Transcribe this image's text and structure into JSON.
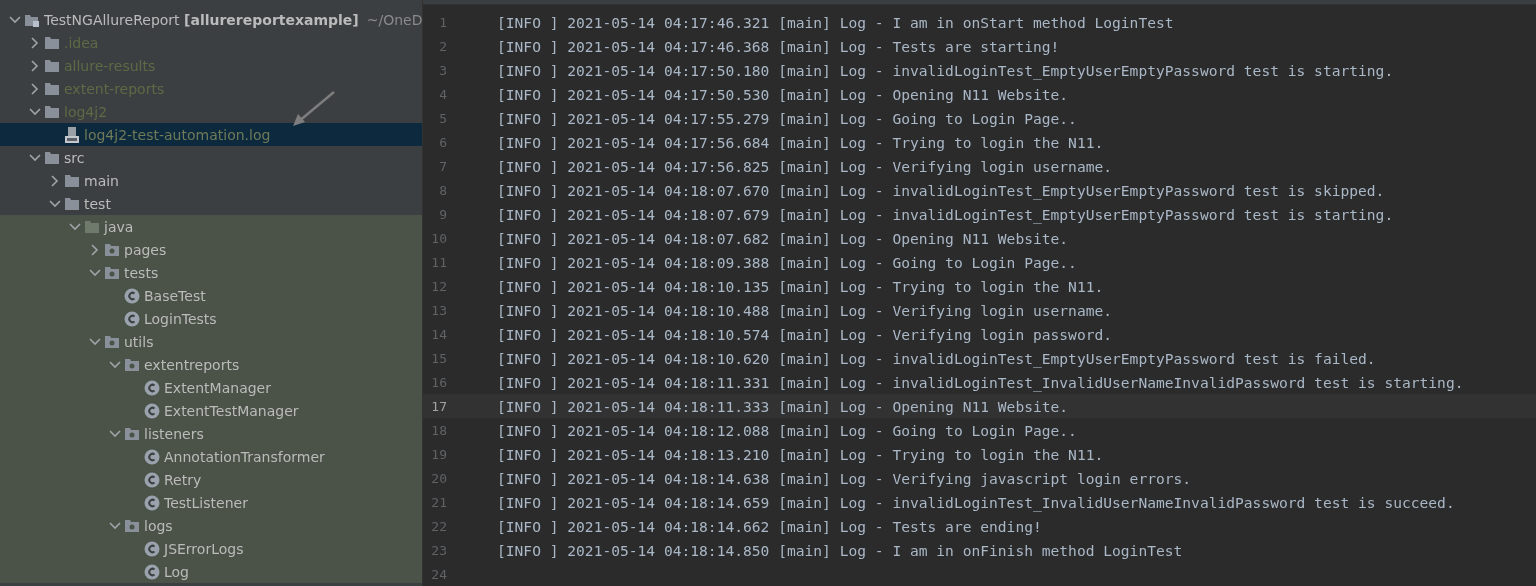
{
  "project_tree": [
    {
      "kind": "module",
      "label": "TestNGAllureReport **[allurereportexample]**",
      "path": "~/OneD",
      "expanded": true,
      "selected": false,
      "children": [
        {
          "kind": "folder",
          "label": ".idea",
          "excluded": true,
          "expanded": false,
          "selected": false
        },
        {
          "kind": "folder",
          "label": "allure-results",
          "excluded": true,
          "expanded": false,
          "selected": false
        },
        {
          "kind": "folder",
          "label": "extent-reports",
          "excluded": true,
          "expanded": false,
          "selected": false
        },
        {
          "kind": "folder",
          "label": "log4j2",
          "excluded": true,
          "expanded": true,
          "selected": false,
          "children": [
            {
              "kind": "log",
              "label": "log4j2-test-automation.log",
              "excluded": true,
              "selected": true
            }
          ]
        },
        {
          "kind": "folder",
          "label": "src",
          "excluded": false,
          "expanded": true,
          "selected": false,
          "children": [
            {
              "kind": "folder",
              "label": "main",
              "excluded": false,
              "expanded": false,
              "selected": false
            },
            {
              "kind": "folder",
              "label": "test",
              "excluded": false,
              "expanded": true,
              "selected": false,
              "children": [
                {
                  "kind": "test-root",
                  "label": "java",
                  "excluded": false,
                  "expanded": true,
                  "selected": false,
                  "children": [
                    {
                      "kind": "package",
                      "label": "pages",
                      "excluded": false,
                      "expanded": false,
                      "selected": false
                    },
                    {
                      "kind": "package",
                      "label": "tests",
                      "excluded": false,
                      "expanded": true,
                      "selected": false,
                      "children": [
                        {
                          "kind": "class",
                          "label": "BaseTest",
                          "excluded": false,
                          "selected": false
                        },
                        {
                          "kind": "class",
                          "label": "LoginTests",
                          "excluded": false,
                          "selected": false
                        }
                      ]
                    },
                    {
                      "kind": "package",
                      "label": "utils",
                      "excluded": false,
                      "expanded": true,
                      "selected": false,
                      "children": [
                        {
                          "kind": "package",
                          "label": "extentreports",
                          "excluded": false,
                          "expanded": true,
                          "selected": false,
                          "children": [
                            {
                              "kind": "class",
                              "label": "ExtentManager",
                              "excluded": false,
                              "selected": false
                            },
                            {
                              "kind": "class",
                              "label": "ExtentTestManager",
                              "excluded": false,
                              "selected": false
                            }
                          ]
                        },
                        {
                          "kind": "package",
                          "label": "listeners",
                          "excluded": false,
                          "expanded": true,
                          "selected": false,
                          "children": [
                            {
                              "kind": "class",
                              "label": "AnnotationTransformer",
                              "excluded": false,
                              "selected": false
                            },
                            {
                              "kind": "class",
                              "label": "Retry",
                              "excluded": false,
                              "selected": false
                            },
                            {
                              "kind": "class",
                              "label": "TestListener",
                              "excluded": false,
                              "selected": false
                            }
                          ]
                        },
                        {
                          "kind": "package",
                          "label": "logs",
                          "excluded": false,
                          "expanded": true,
                          "selected": false,
                          "children": [
                            {
                              "kind": "class",
                              "label": "JSErrorLogs",
                              "excluded": false,
                              "selected": false
                            },
                            {
                              "kind": "class",
                              "label": "Log",
                              "excluded": false,
                              "selected": false
                            }
                          ]
                        }
                      ]
                    }
                  ]
                }
              ]
            }
          ]
        }
      ]
    }
  ],
  "editor": {
    "lines": [
      {
        "number": "1",
        "text": "[INFO ] 2021-05-14 04:17:46.321 [main] Log - I am in onStart method LoginTest",
        "current": false
      },
      {
        "number": "2",
        "text": "[INFO ] 2021-05-14 04:17:46.368 [main] Log - Tests are starting!",
        "current": false
      },
      {
        "number": "3",
        "text": "[INFO ] 2021-05-14 04:17:50.180 [main] Log - invalidLoginTest_EmptyUserEmptyPassword test is starting.",
        "current": false
      },
      {
        "number": "4",
        "text": "[INFO ] 2021-05-14 04:17:50.530 [main] Log - Opening N11 Website.",
        "current": false
      },
      {
        "number": "5",
        "text": "[INFO ] 2021-05-14 04:17:55.279 [main] Log - Going to Login Page..",
        "current": false
      },
      {
        "number": "6",
        "text": "[INFO ] 2021-05-14 04:17:56.684 [main] Log - Trying to login the N11.",
        "current": false
      },
      {
        "number": "7",
        "text": "[INFO ] 2021-05-14 04:17:56.825 [main] Log - Verifying login username.",
        "current": false
      },
      {
        "number": "8",
        "text": "[INFO ] 2021-05-14 04:18:07.670 [main] Log - invalidLoginTest_EmptyUserEmptyPassword test is skipped.",
        "current": false
      },
      {
        "number": "9",
        "text": "[INFO ] 2021-05-14 04:18:07.679 [main] Log - invalidLoginTest_EmptyUserEmptyPassword test is starting.",
        "current": false
      },
      {
        "number": "10",
        "text": "[INFO ] 2021-05-14 04:18:07.682 [main] Log - Opening N11 Website.",
        "current": false
      },
      {
        "number": "11",
        "text": "[INFO ] 2021-05-14 04:18:09.388 [main] Log - Going to Login Page..",
        "current": false
      },
      {
        "number": "12",
        "text": "[INFO ] 2021-05-14 04:18:10.135 [main] Log - Trying to login the N11.",
        "current": false
      },
      {
        "number": "13",
        "text": "[INFO ] 2021-05-14 04:18:10.488 [main] Log - Verifying login username.",
        "current": false
      },
      {
        "number": "14",
        "text": "[INFO ] 2021-05-14 04:18:10.574 [main] Log - Verifying login password.",
        "current": false
      },
      {
        "number": "15",
        "text": "[INFO ] 2021-05-14 04:18:10.620 [main] Log - invalidLoginTest_EmptyUserEmptyPassword test is failed.",
        "current": false
      },
      {
        "number": "16",
        "text": "[INFO ] 2021-05-14 04:18:11.331 [main] Log - invalidLoginTest_InvalidUserNameInvalidPassword test is starting.",
        "current": false
      },
      {
        "number": "17",
        "text": "[INFO ] 2021-05-14 04:18:11.333 [main] Log - Opening N11 Website.",
        "current": true
      },
      {
        "number": "18",
        "text": "[INFO ] 2021-05-14 04:18:12.088 [main] Log - Going to Login Page..",
        "current": false
      },
      {
        "number": "19",
        "text": "[INFO ] 2021-05-14 04:18:13.210 [main] Log - Trying to login the N11.",
        "current": false
      },
      {
        "number": "20",
        "text": "[INFO ] 2021-05-14 04:18:14.638 [main] Log - Verifying javascript login errors.",
        "current": false
      },
      {
        "number": "21",
        "text": "[INFO ] 2021-05-14 04:18:14.659 [main] Log - invalidLoginTest_InvalidUserNameInvalidPassword test is succeed.",
        "current": false
      },
      {
        "number": "22",
        "text": "[INFO ] 2021-05-14 04:18:14.662 [main] Log - Tests are ending!",
        "current": false
      },
      {
        "number": "23",
        "text": "[INFO ] 2021-05-14 04:18:14.850 [main] Log - I am in onFinish method LoginTest",
        "current": false
      },
      {
        "number": "24",
        "current": false
      }
    ]
  }
}
